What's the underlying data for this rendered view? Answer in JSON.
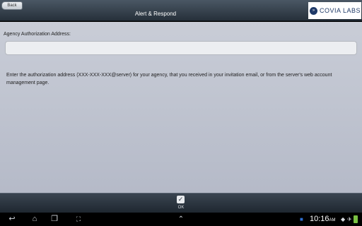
{
  "header": {
    "back_label": "Back",
    "title": "Alert & Respond",
    "logo_text": "COVIA LABS"
  },
  "form": {
    "label": "Agency Authorization Address:",
    "value": "",
    "placeholder": "",
    "help": "Enter the authorization address (XXX-XXX-XXX@server) for your agency, that you received in your invitation email, or from the server's web account management page."
  },
  "actions": {
    "ok_label": "OK"
  },
  "statusbar": {
    "time": "10:16",
    "time_suffix": "AM"
  },
  "colors": {
    "accent": "#1f3a68",
    "battery": "#7ac143"
  }
}
